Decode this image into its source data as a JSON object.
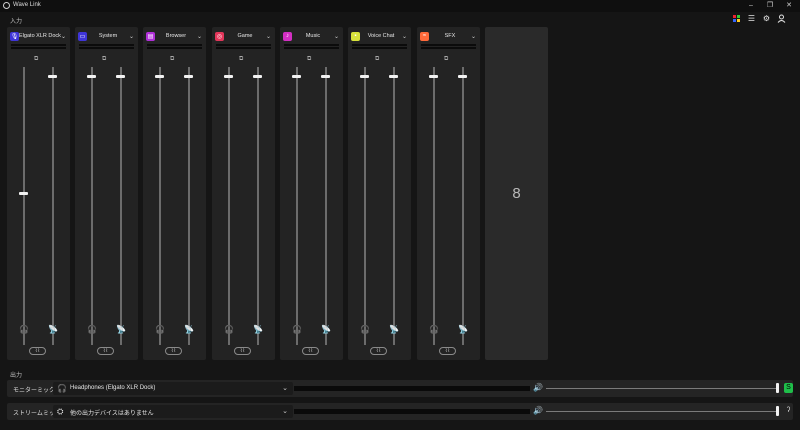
{
  "window": {
    "title": "Wave Link",
    "minimize_icon": "minimize-icon",
    "restore_icon": "restore-icon",
    "close_icon": "close-icon"
  },
  "sections": {
    "input": "入力",
    "output": "出力"
  },
  "toolbar": {
    "icons": [
      "color-palette-icon",
      "sliders-icon",
      "gear-icon",
      "account-icon"
    ]
  },
  "channels": [
    {
      "name": "Elgato XLR Dock",
      "icon": "microphone-icon",
      "color": "#3f35d8",
      "glyph": "🎙",
      "monitor_level": 0.55,
      "stream_level": 0.97
    },
    {
      "name": "System",
      "icon": "monitor-icon",
      "color": "#3f35d8",
      "glyph": "▭",
      "monitor_level": 0.97,
      "stream_level": 0.97
    },
    {
      "name": "Browser",
      "icon": "browser-icon",
      "color": "#b02fd8",
      "glyph": "▤",
      "monitor_level": 0.97,
      "stream_level": 0.97
    },
    {
      "name": "Game",
      "icon": "gamepad-icon",
      "color": "#e2365a",
      "glyph": "◎",
      "monitor_level": 0.97,
      "stream_level": 0.97
    },
    {
      "name": "Music",
      "icon": "music-note-icon",
      "color": "#d42fc4",
      "glyph": "♪",
      "monitor_level": 0.97,
      "stream_level": 0.97
    },
    {
      "name": "Voice Chat",
      "icon": "voice-chat-icon",
      "color": "#d8e23a",
      "glyph": "▪",
      "monitor_level": 0.97,
      "stream_level": 0.97
    },
    {
      "name": "SFX",
      "icon": "waveform-icon",
      "color": "#ff6a3a",
      "glyph": "≈",
      "monitor_level": 0.97,
      "stream_level": 0.97
    }
  ],
  "empty_slot": {
    "label": "8"
  },
  "outputs": [
    {
      "label": "モニターミックス",
      "device": "Headphones (Elgato XLR Dock)",
      "device_icon": "headphones-icon",
      "device_glyph": "🎧",
      "volume": 0.99,
      "end_icon": "green-toggle-icon",
      "end_glyph": "S",
      "end_color": "#1fbf4a"
    },
    {
      "label": "ストリームミックス",
      "device": "他の出力デバイスはありません",
      "device_icon": "stream-icon",
      "device_glyph": "⛭",
      "volume": 0.99,
      "end_icon": "ear-icon",
      "end_glyph": "ʔ",
      "end_color": "transparent"
    }
  ]
}
